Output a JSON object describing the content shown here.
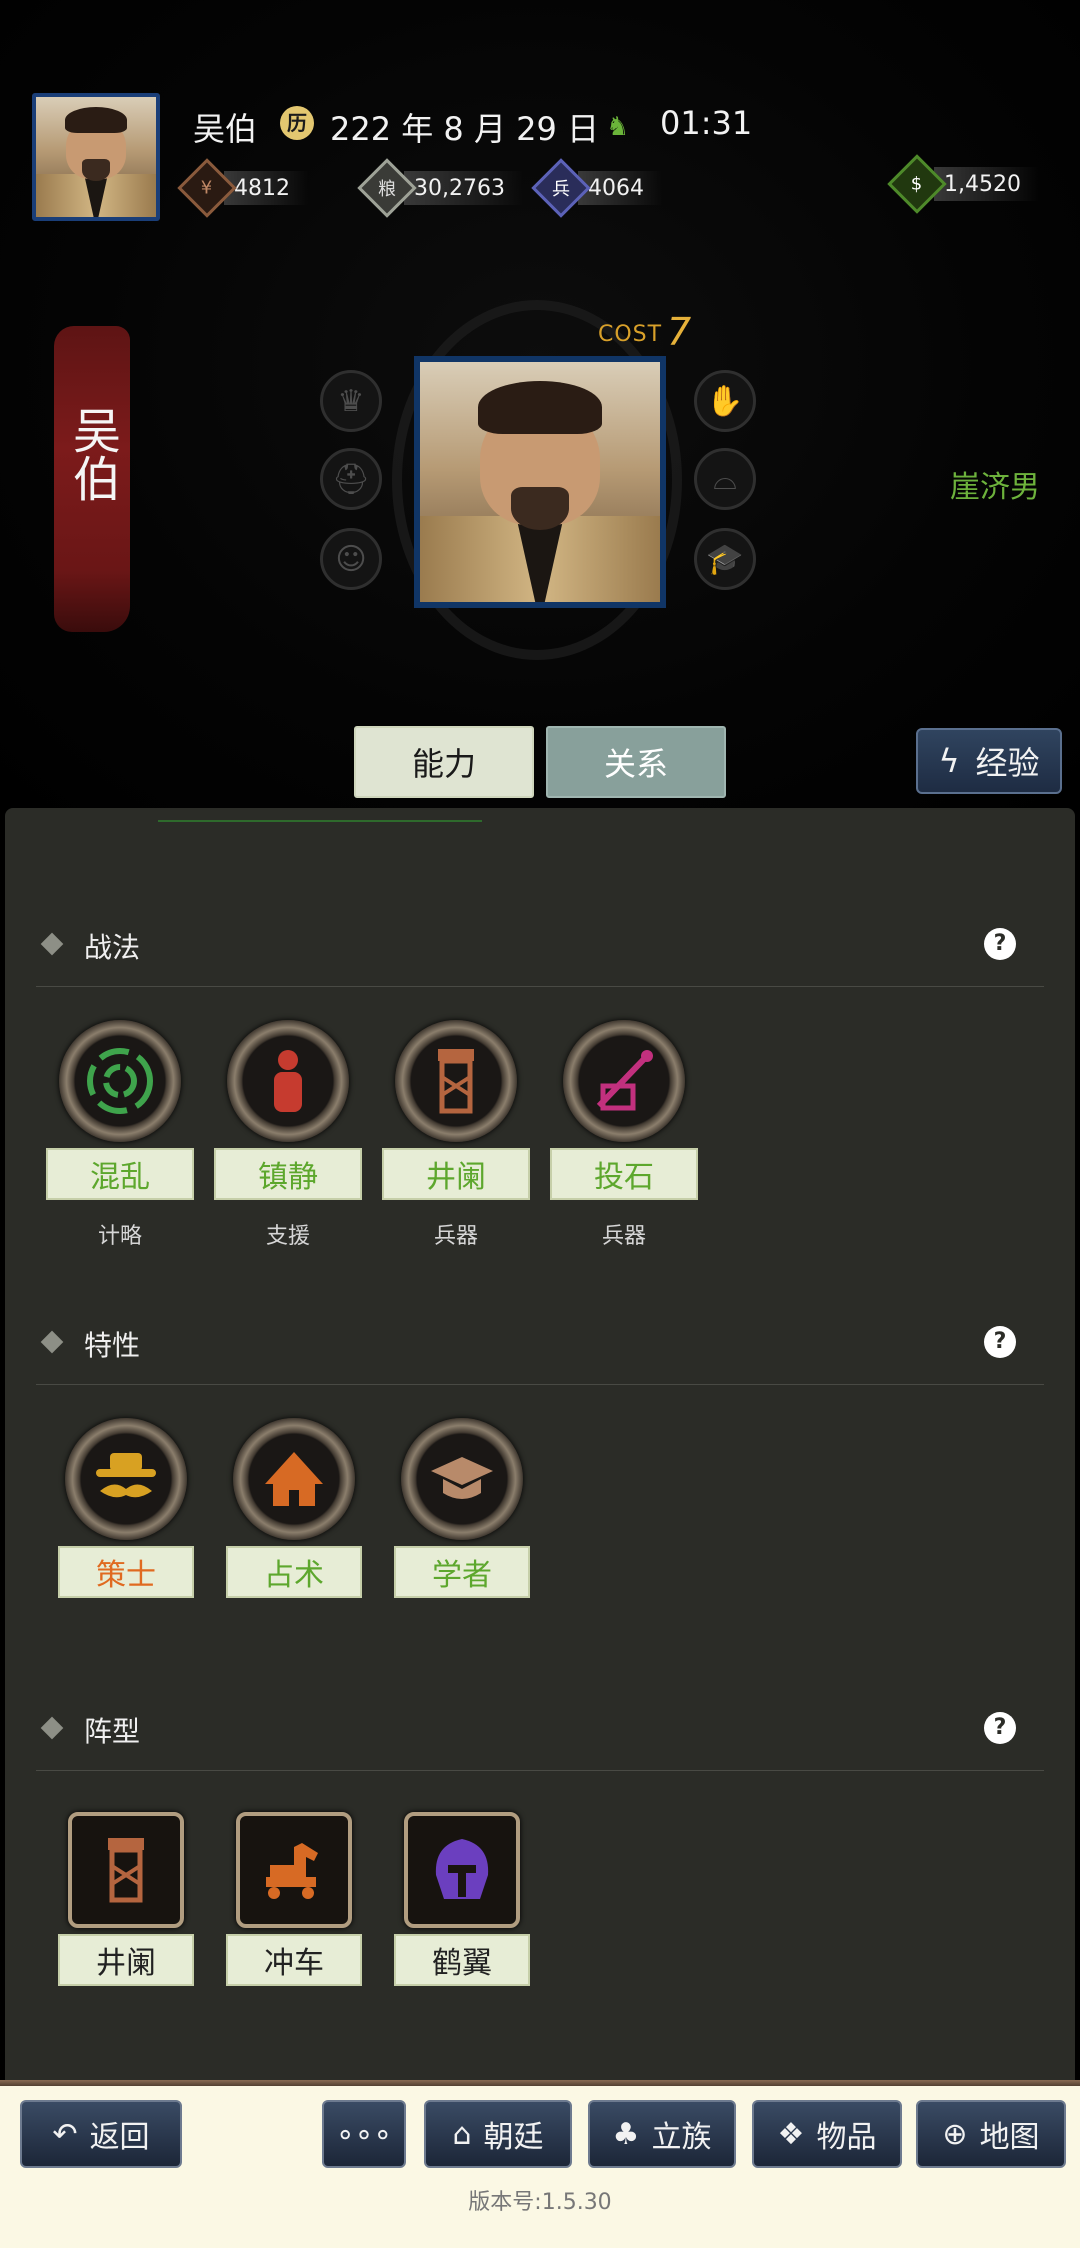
{
  "header": {
    "name": "吴伯",
    "date": "222 年 8 月 29 日",
    "time": "01:31",
    "resources": [
      {
        "icon": "money-icon",
        "value": "4812",
        "color": "#8a5a3c"
      },
      {
        "icon": "rice-icon",
        "value": "30,2763",
        "color": "#9ea297"
      },
      {
        "icon": "soldier-icon",
        "value": "4064",
        "color": "#5c62b8"
      },
      {
        "icon": "gold-bag-icon",
        "value": "1,4520",
        "color": "#4e8a2a"
      }
    ]
  },
  "general": {
    "banner_name": "吴伯",
    "cost_label": "COST",
    "cost_value": "7",
    "home": "崖济男"
  },
  "tabs": {
    "ability": "能力",
    "relation": "关系",
    "experience": "经验"
  },
  "sections": {
    "tactics": {
      "title": "战法",
      "items": [
        {
          "name": "混乱",
          "type": "计略",
          "icon": "swirl-icon"
        },
        {
          "name": "镇静",
          "type": "支援",
          "icon": "calm-figure-icon"
        },
        {
          "name": "井阑",
          "type": "兵器",
          "icon": "siege-tower-icon"
        },
        {
          "name": "投石",
          "type": "兵器",
          "icon": "catapult-icon"
        }
      ]
    },
    "traits": {
      "title": "特性",
      "items": [
        {
          "name": "策士",
          "icon": "strategist-hat-icon"
        },
        {
          "name": "占术",
          "icon": "divination-icon"
        },
        {
          "name": "学者",
          "icon": "scholar-cap-icon"
        }
      ]
    },
    "formations": {
      "title": "阵型",
      "items": [
        {
          "name": "井阑",
          "icon": "siege-tower-icon"
        },
        {
          "name": "冲车",
          "icon": "ram-horse-icon"
        },
        {
          "name": "鹤翼",
          "icon": "helmet-icon"
        }
      ]
    }
  },
  "bottom_bar": {
    "back": "返回",
    "more": "∘∘∘",
    "court": "朝廷",
    "clan": "立族",
    "items": "物品",
    "map": "地图",
    "version": "版本号:1.5.30"
  }
}
